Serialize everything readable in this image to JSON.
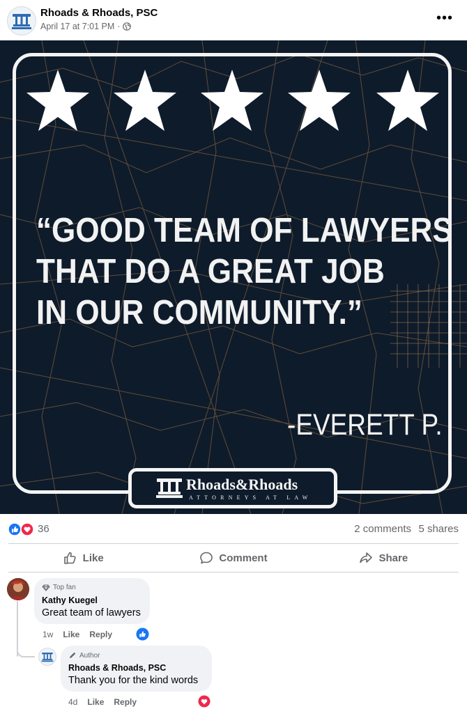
{
  "post": {
    "page_name": "Rhoads & Rhoads, PSC",
    "timestamp": "April 17 at 7:01 PM",
    "separator": "·",
    "privacy_icon": "globe-icon",
    "more_label": "•••"
  },
  "image": {
    "stars": 5,
    "quote_text": "“GOOD TEAM OF LAWYERS\nTHAT DO A GREAT JOB\nIN OUR COMMUNITY.”",
    "attribution": "-EVERETT P.",
    "logo_name": "Rhoads&Rhoads",
    "logo_tagline": "ATTORNEYS AT LAW",
    "colors": {
      "background": "#0e1b2b",
      "map_lines": "#8a6a44",
      "frame": "#f4f4f4"
    }
  },
  "reactions": {
    "icons": [
      "like-icon",
      "love-icon"
    ],
    "count": "36",
    "comments": "2 comments",
    "shares": "5 shares"
  },
  "actions": {
    "like": "Like",
    "comment": "Comment",
    "share": "Share"
  },
  "comments": [
    {
      "badge": "Top fan",
      "author": "Kathy Kuegel",
      "text": "Great team of lawyers",
      "time": "1w",
      "like": "Like",
      "reply": "Reply",
      "reaction_icon": "like-icon"
    },
    {
      "badge": "Author",
      "author": "Rhoads & Rhoads, PSC",
      "text": "Thank you for the kind words",
      "time": "4d",
      "like": "Like",
      "reply": "Reply",
      "reaction_icon": "love-icon"
    }
  ],
  "colors": {
    "accent_blue": "#1877f2",
    "love_red": "#f02849",
    "muted_text": "#65676b"
  }
}
